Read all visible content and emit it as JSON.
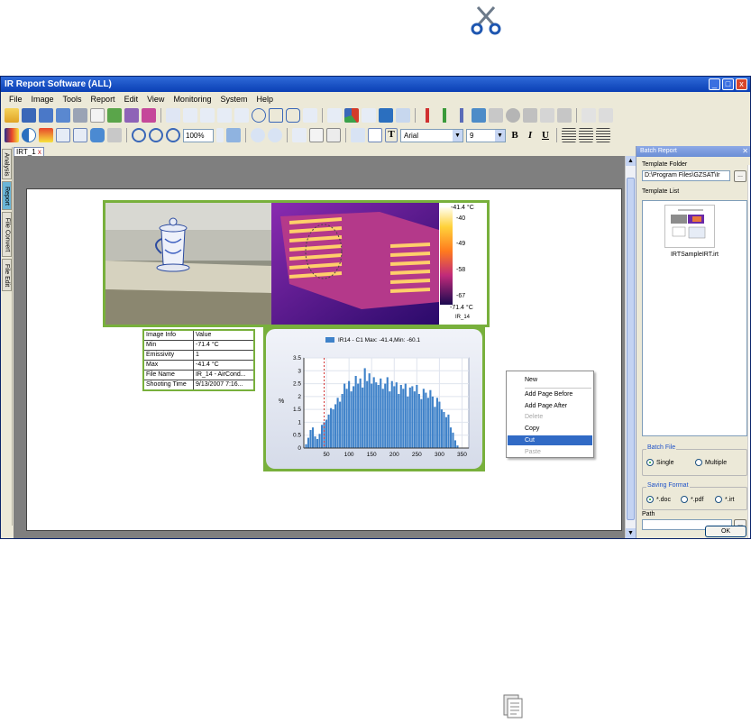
{
  "window": {
    "title": "IR Report Software (ALL)",
    "min": "_",
    "max": "□",
    "close": "x"
  },
  "menu": [
    "File",
    "Image",
    "Tools",
    "Report",
    "Edit",
    "View",
    "Monitoring",
    "System",
    "Help"
  ],
  "toolbar": {
    "zoom": "100%",
    "font": "Arial",
    "font_size": "9",
    "bold": "B",
    "italic": "I",
    "underline": "U",
    "text_tool": "T"
  },
  "doc_tab": {
    "label": "IRT_1",
    "close": "x"
  },
  "side_tabs": [
    "Analysis",
    "Report",
    "File Convert",
    "File Edit"
  ],
  "thermal_scale": {
    "max": "-41.4 °C",
    "min": "-71.4 °C",
    "ticks": [
      "-40",
      "-49",
      "-58",
      "-67"
    ],
    "image_name": "IR_14"
  },
  "info_table": {
    "rows": [
      [
        "Image Info",
        "Value"
      ],
      [
        "Min",
        "-71.4 °C"
      ],
      [
        "Emissivity",
        "1"
      ],
      [
        "Max",
        "-41.4 °C"
      ],
      [
        "File Name",
        "IR_14 - AirCond..."
      ],
      [
        "Shooting Time",
        "9/13/2007 7:16..."
      ]
    ]
  },
  "chart_data": {
    "type": "bar",
    "title": "",
    "legend": "IR14 - C1 Max: -41.4,Min: -60.1",
    "ylabel": "%",
    "xlabel": "",
    "ylim": [
      0,
      3.5
    ],
    "xlim": [
      0,
      365
    ],
    "yticks": [
      "0",
      "0.5",
      "1",
      "1.5",
      "2",
      "2.5",
      "3",
      "3.5"
    ],
    "xticks": [
      "50",
      "100",
      "150",
      "200",
      "250",
      "300",
      "350"
    ],
    "marker_x": 45,
    "x": [
      5,
      10,
      15,
      20,
      25,
      30,
      35,
      40,
      45,
      50,
      55,
      60,
      65,
      70,
      75,
      80,
      85,
      90,
      95,
      100,
      105,
      110,
      115,
      120,
      125,
      130,
      135,
      140,
      145,
      150,
      155,
      160,
      165,
      170,
      175,
      180,
      185,
      190,
      195,
      200,
      205,
      210,
      215,
      220,
      225,
      230,
      235,
      240,
      245,
      250,
      255,
      260,
      265,
      270,
      275,
      280,
      285,
      290,
      295,
      300,
      305,
      310,
      315,
      320,
      325,
      330,
      335,
      340
    ],
    "values": [
      0.15,
      0.4,
      0.7,
      0.8,
      0.45,
      0.35,
      0.55,
      0.9,
      1.0,
      1.1,
      1.3,
      1.55,
      1.5,
      1.7,
      1.95,
      1.8,
      2.1,
      2.5,
      2.3,
      2.6,
      2.2,
      2.4,
      2.8,
      2.5,
      2.7,
      2.35,
      3.1,
      2.6,
      2.9,
      2.5,
      2.75,
      2.55,
      2.45,
      2.7,
      2.3,
      2.5,
      2.75,
      2.2,
      2.6,
      2.4,
      2.55,
      2.1,
      2.45,
      2.3,
      2.5,
      2.0,
      2.35,
      2.4,
      2.2,
      2.45,
      2.1,
      1.9,
      2.3,
      2.15,
      1.95,
      2.25,
      2.0,
      1.6,
      1.95,
      1.8,
      1.5,
      1.4,
      1.2,
      1.3,
      0.8,
      0.6,
      0.3,
      0.1
    ]
  },
  "context_menu": {
    "items": [
      {
        "label": "New",
        "state": "normal"
      },
      {
        "label": "Add Page Before",
        "state": "normal"
      },
      {
        "label": "Add Page After",
        "state": "normal"
      },
      {
        "label": "Delete",
        "state": "disabled"
      },
      {
        "label": "Copy",
        "state": "normal"
      },
      {
        "label": "Cut",
        "state": "selected"
      },
      {
        "label": "Paste",
        "state": "disabled"
      }
    ]
  },
  "batch_panel": {
    "title": "Batch Report",
    "template_folder_label": "Template Folder",
    "template_folder_value": "D:\\Program Files\\GZSAT\\Ir",
    "browse": "...",
    "template_list_label": "Template List",
    "template_name": "IRTSampleIRT.irt",
    "batch_file_label": "Batch File",
    "batch_single": "Single",
    "batch_multiple": "Multiple",
    "saving_format_label": "Saving Format",
    "fmt_doc": "*.doc",
    "fmt_pdf": "*.pdf",
    "fmt_irt": "*.irt",
    "path_label": "Path",
    "path_value": "",
    "ok": "OK"
  },
  "colors": {
    "accent_green": "#78b03c",
    "bar_blue": "#3f82c9",
    "selected": "#316ac5"
  },
  "icons": {
    "floating_top": "scissors-icon",
    "floating_bottom": "paste-icon"
  }
}
